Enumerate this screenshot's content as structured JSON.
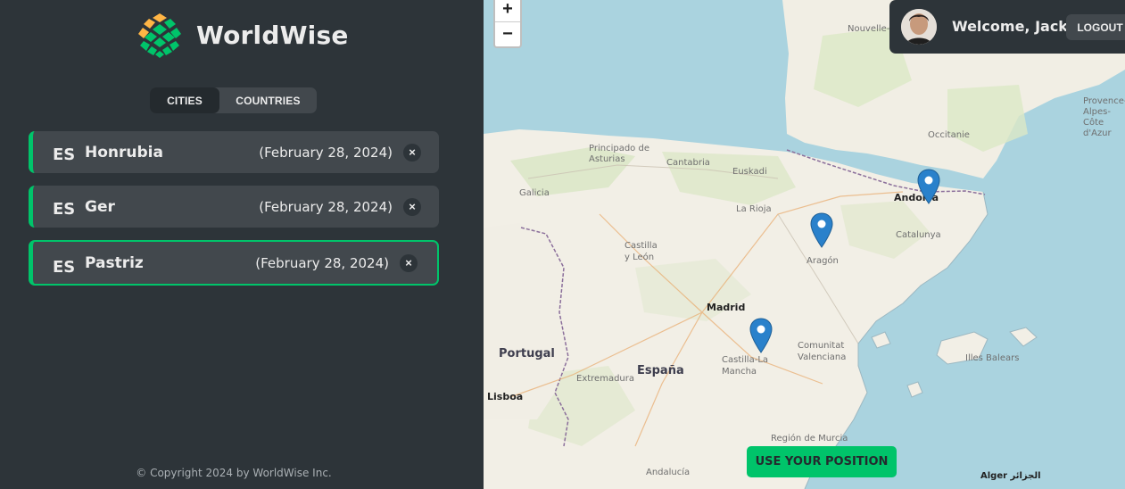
{
  "app": {
    "name": "WorldWise"
  },
  "tabs": {
    "cities": "CITIES",
    "countries": "COUNTRIES"
  },
  "cities": [
    {
      "flag": "ES",
      "name": "Honrubia",
      "date": "(February 28, 2024)",
      "delete": "×"
    },
    {
      "flag": "ES",
      "name": "Ger",
      "date": "(February 28, 2024)",
      "delete": "×"
    },
    {
      "flag": "ES",
      "name": "Pastriz",
      "date": "(February 28, 2024)",
      "delete": "×"
    }
  ],
  "footer": {
    "copyright": "© Copyright 2024 by WorldWise Inc."
  },
  "map": {
    "zoom_in": "+",
    "zoom_out": "−",
    "use_position": "USE YOUR POSITION",
    "labels": {
      "nouvelle_aquitaine": "Nouvelle-Aquitaine",
      "occitanie": "Occitanie",
      "provence": "Provence-Alpes-Côte d'Azur",
      "asturias": "Principado de Asturias",
      "cantabria": "Cantabria",
      "euskadi": "Euskadi",
      "galicia": "Galicia",
      "la_rioja": "La Rioja",
      "andorra": "Andorra",
      "castilla_leon": "Castilla y León",
      "aragon": "Aragón",
      "catalunya": "Catalunya",
      "madrid": "Madrid",
      "portugal": "Portugal",
      "espana": "España",
      "extremadura": "Extremadura",
      "castilla_mancha": "Castilla-La Mancha",
      "valenciana": "Comunitat Valenciana",
      "illes_balears": "Illes Balears",
      "lisboa": "Lisboa",
      "region_murcia": "Región de Murcia",
      "andalucia": "Andalucía",
      "alger": "Alger الجزائر"
    }
  },
  "user": {
    "welcome": "Welcome, Jack",
    "logout": "LOGOUT"
  },
  "colors": {
    "accent": "#00c46a",
    "dark": "#2d3439",
    "panel": "#42484d"
  }
}
